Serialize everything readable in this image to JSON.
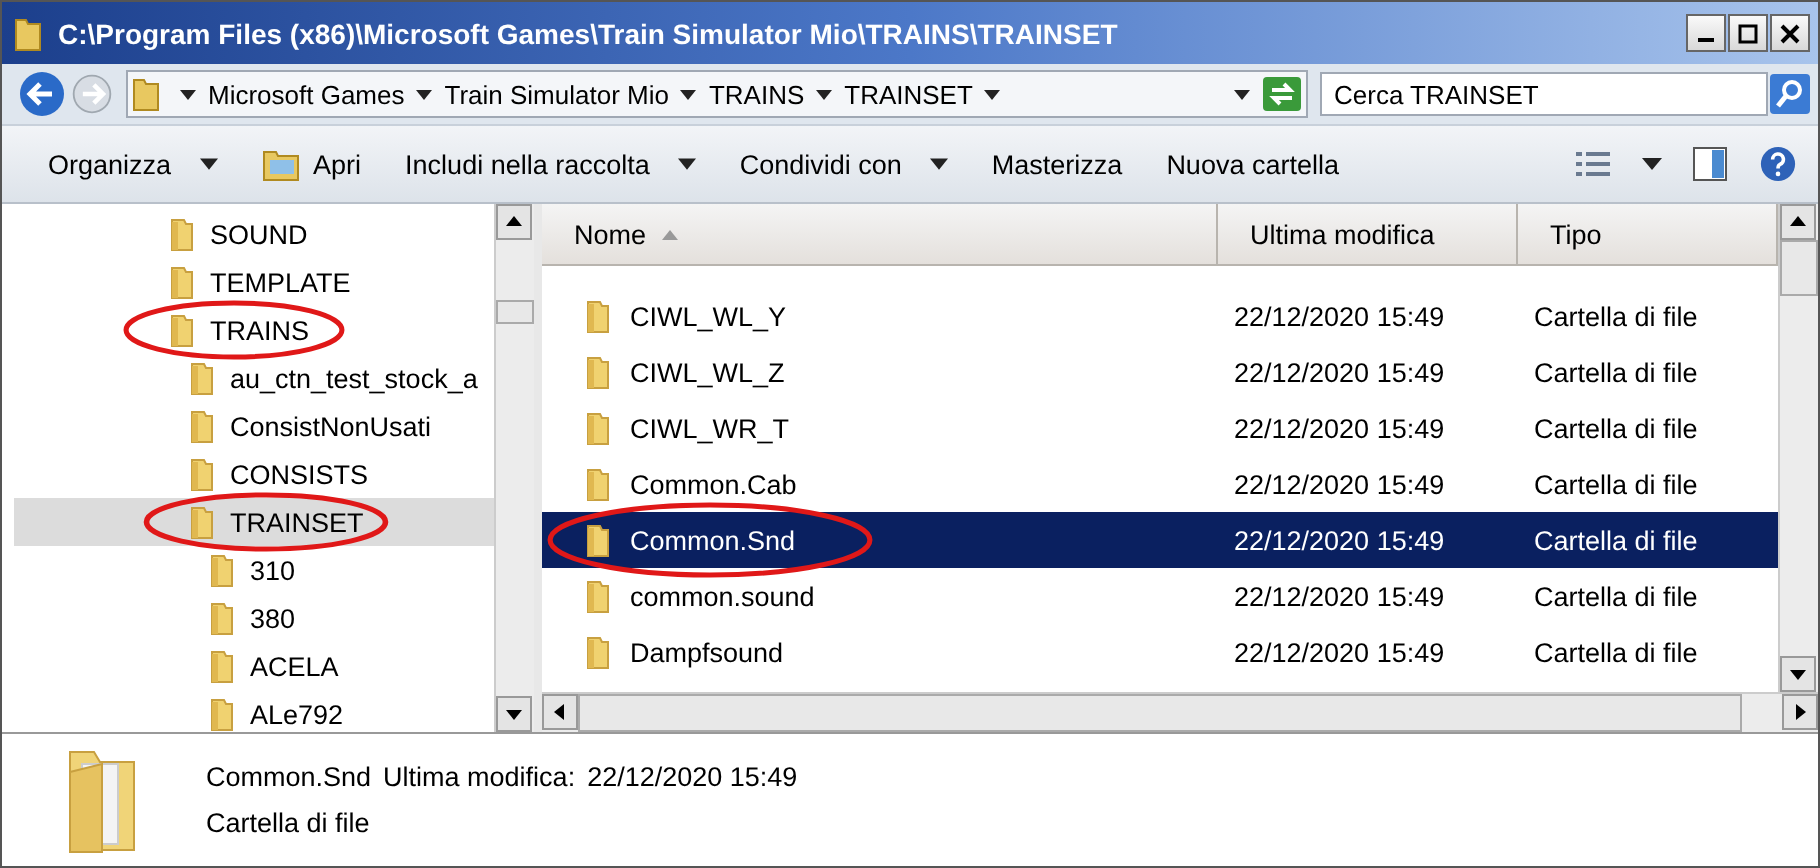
{
  "window": {
    "title": "C:\\Program Files (x86)\\Microsoft Games\\Train Simulator Mio\\TRAINS\\TRAINSET"
  },
  "address": {
    "crumbs": [
      "Microsoft Games",
      "Train Simulator Mio",
      "TRAINS",
      "TRAINSET"
    ],
    "search": {
      "placeholder": "Cerca TRAINSET"
    }
  },
  "toolbar": [
    {
      "label": "Organizza",
      "kind": "menu"
    },
    {
      "label": "Apri",
      "kind": "open"
    },
    {
      "label": "Includi nella raccolta",
      "kind": "menu"
    },
    {
      "label": "Condividi con",
      "kind": "menu"
    },
    {
      "label": "Masterizza",
      "kind": "plain"
    },
    {
      "label": "Nuova cartella",
      "kind": "plain"
    }
  ],
  "tree": [
    {
      "label": "SOUND",
      "selected": false,
      "circled": false
    },
    {
      "label": "TEMPLATE",
      "selected": false,
      "circled": false
    },
    {
      "label": "TRAINS",
      "selected": false,
      "circled": true,
      "children": [
        {
          "label": "au_ctn_test_stock_a",
          "selected": false,
          "circled": false
        },
        {
          "label": "ConsistNonUsati",
          "selected": false,
          "circled": false
        },
        {
          "label": "CONSISTS",
          "selected": false,
          "circled": false
        },
        {
          "label": "TRAINSET",
          "selected": true,
          "circled": true,
          "children": [
            {
              "label": "310",
              "selected": false,
              "circled": false
            },
            {
              "label": "380",
              "selected": false,
              "circled": false
            },
            {
              "label": "ACELA",
              "selected": false,
              "circled": false
            },
            {
              "label": "ALe792",
              "selected": false,
              "circled": false
            }
          ]
        }
      ]
    }
  ],
  "table": {
    "columns": [
      "Nome",
      "Ultima modifica",
      "Tipo"
    ],
    "rows": [
      {
        "name": "CIWL_WL_Y",
        "modified": "22/12/2020 15:49",
        "type": "Cartella di file",
        "selected": false,
        "circled": false
      },
      {
        "name": "CIWL_WL_Z",
        "modified": "22/12/2020 15:49",
        "type": "Cartella di file",
        "selected": false,
        "circled": false
      },
      {
        "name": "CIWL_WR_T",
        "modified": "22/12/2020 15:49",
        "type": "Cartella di file",
        "selected": false,
        "circled": false
      },
      {
        "name": "Common.Cab",
        "modified": "22/12/2020 15:49",
        "type": "Cartella di file",
        "selected": false,
        "circled": false
      },
      {
        "name": "Common.Snd",
        "modified": "22/12/2020 15:49",
        "type": "Cartella di file",
        "selected": true,
        "circled": true
      },
      {
        "name": "common.sound",
        "modified": "22/12/2020 15:49",
        "type": "Cartella di file",
        "selected": false,
        "circled": false
      },
      {
        "name": "Dampfsound",
        "modified": "22/12/2020 15:49",
        "type": "Cartella di file",
        "selected": false,
        "circled": false
      }
    ]
  },
  "details": {
    "name": "Common.Snd",
    "modified_label": "Ultima modifica:",
    "modified": "22/12/2020 15:49",
    "type": "Cartella di file"
  }
}
